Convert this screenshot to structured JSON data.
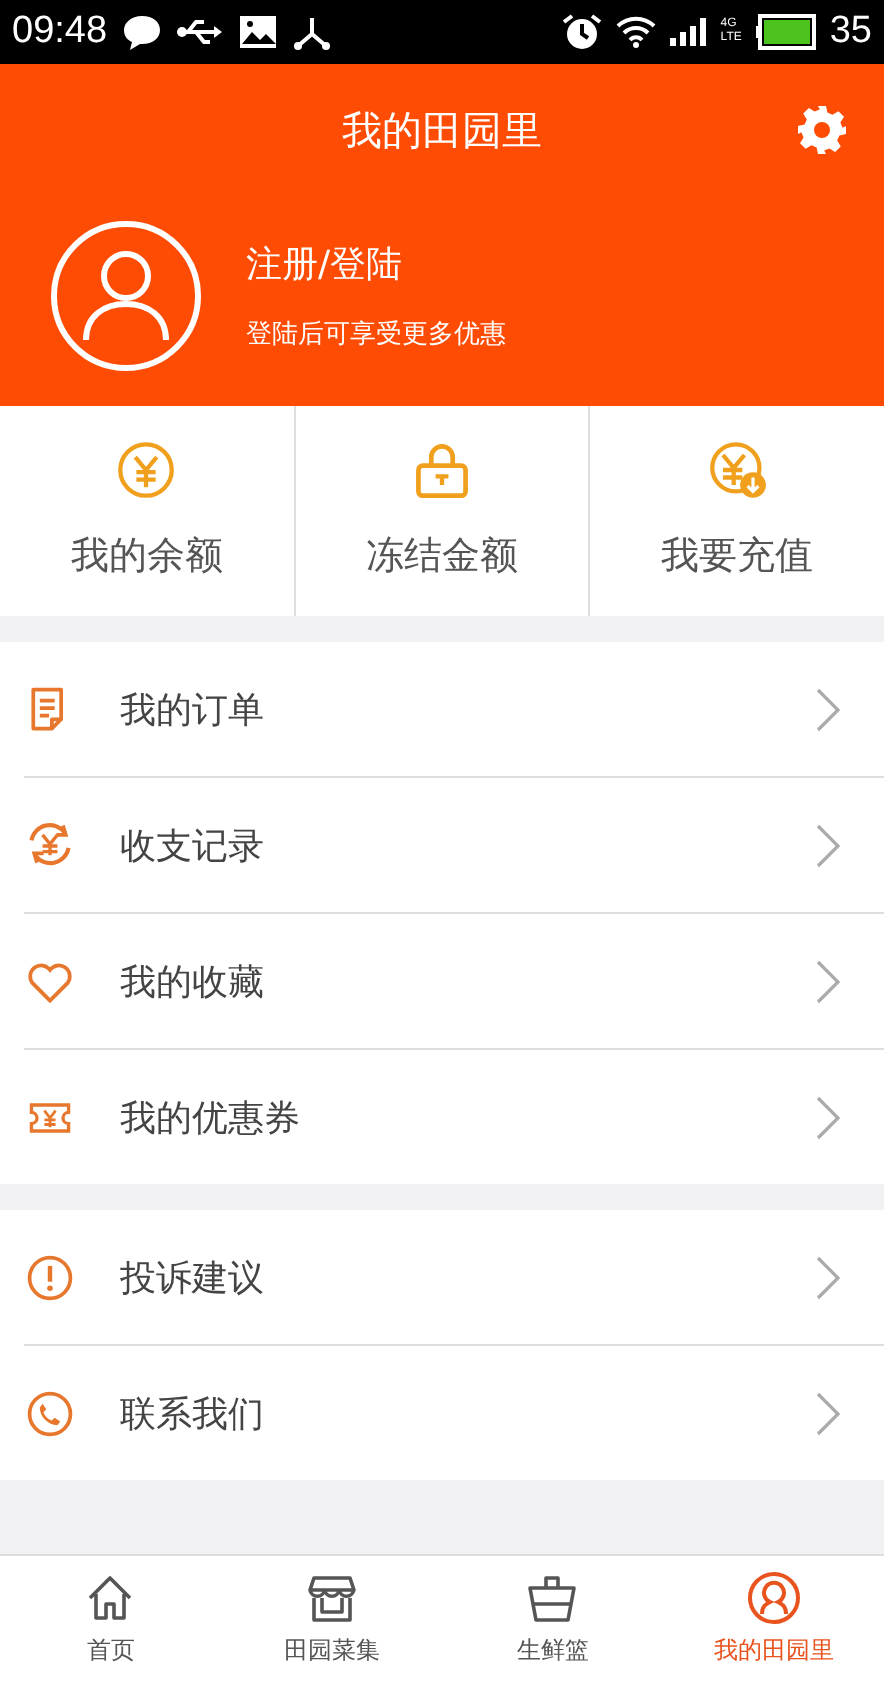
{
  "status_bar": {
    "time": "09:48",
    "network": [
      "4G",
      "LTE"
    ],
    "battery": "35"
  },
  "header": {
    "title": "我的田园里"
  },
  "profile": {
    "name": "注册/登陆",
    "subtitle": "登陆后可享受更多优惠"
  },
  "wallet": [
    {
      "label": "我的余额"
    },
    {
      "label": "冻结金额"
    },
    {
      "label": "我要充值"
    }
  ],
  "menu_groups": [
    [
      {
        "label": "我的订单"
      },
      {
        "label": "收支记录"
      },
      {
        "label": "我的收藏"
      },
      {
        "label": "我的优惠券"
      }
    ],
    [
      {
        "label": "投诉建议"
      },
      {
        "label": "联系我们"
      }
    ]
  ],
  "tab_bar": [
    {
      "label": "首页",
      "selected": false
    },
    {
      "label": "田园菜集",
      "selected": false
    },
    {
      "label": "生鲜篮",
      "selected": false
    },
    {
      "label": "我的田园里",
      "selected": true
    }
  ]
}
